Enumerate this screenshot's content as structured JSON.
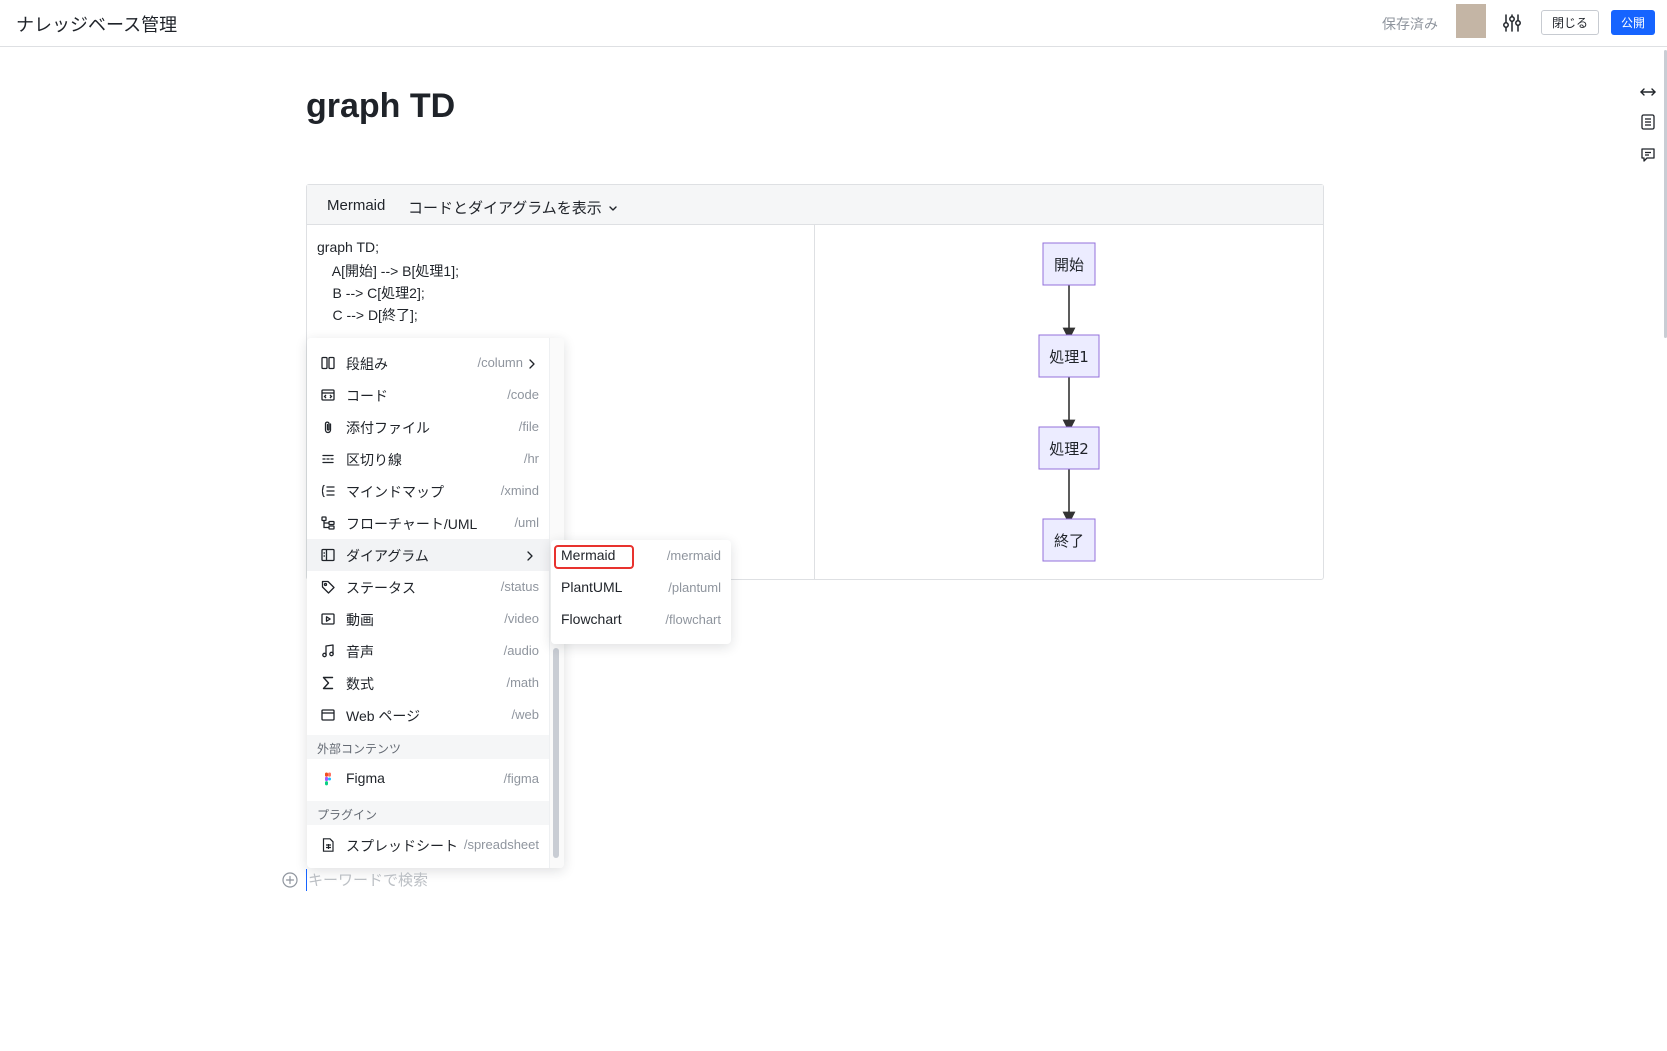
{
  "header": {
    "app_title": "ナレッジベース管理",
    "saved_status": "保存済み",
    "close_label": "閉じる",
    "publish_label": "公開",
    "avatar_color": "#c4b5a5",
    "settings_icon": "sliders-icon"
  },
  "document": {
    "title": "graph TD"
  },
  "mermaid_block": {
    "type_label": "Mermaid",
    "view_mode": "コードとダイアグラムを表示",
    "code_lines": [
      "graph TD;",
      "    A[開始] --> B[処理1];",
      "    B --> C[処理2];",
      "    C --> D[終了];"
    ],
    "diagram_nodes": [
      "開始",
      "処理1",
      "処理2",
      "終了"
    ]
  },
  "slash_menu": {
    "items": [
      {
        "label": "段組み",
        "shortcut": "/column",
        "icon": "columns-icon",
        "has_submenu": true
      },
      {
        "label": "コード",
        "shortcut": "/code",
        "icon": "code-icon"
      },
      {
        "label": "添付ファイル",
        "shortcut": "/file",
        "icon": "paperclip-icon"
      },
      {
        "label": "区切り線",
        "shortcut": "/hr",
        "icon": "divider-icon"
      },
      {
        "label": "マインドマップ",
        "shortcut": "/xmind",
        "icon": "mindmap-icon"
      },
      {
        "label": "フローチャート/UML",
        "shortcut": "/uml",
        "icon": "flowchart-icon"
      },
      {
        "label": "ダイアグラム",
        "shortcut": "",
        "icon": "diagram-icon",
        "has_submenu": true,
        "active": true
      },
      {
        "label": "ステータス",
        "shortcut": "/status",
        "icon": "tag-icon"
      },
      {
        "label": "動画",
        "shortcut": "/video",
        "icon": "video-icon"
      },
      {
        "label": "音声",
        "shortcut": "/audio",
        "icon": "music-note-icon"
      },
      {
        "label": "数式",
        "shortcut": "/math",
        "icon": "sigma-icon"
      },
      {
        "label": "Web ページ",
        "shortcut": "/web",
        "icon": "browser-icon"
      }
    ],
    "section_external": "外部コンテンツ",
    "external_items": [
      {
        "label": "Figma",
        "shortcut": "/figma",
        "icon": "figma-icon"
      }
    ],
    "section_plugins": "プラグイン",
    "plugin_items": [
      {
        "label": "スプレッドシート",
        "shortcut": "/spreadsheet",
        "icon": "spreadsheet-icon"
      }
    ]
  },
  "diagram_submenu": {
    "items": [
      {
        "label": "Mermaid",
        "shortcut": "/mermaid",
        "highlighted": true
      },
      {
        "label": "PlantUML",
        "shortcut": "/plantuml"
      },
      {
        "label": "Flowchart",
        "shortcut": "/flowchart"
      }
    ]
  },
  "search": {
    "placeholder": "キーワードで検索"
  },
  "colors": {
    "accent": "#1664ff",
    "highlight_border": "#e8322e",
    "node_fill": "#ececff",
    "node_stroke": "#9370db"
  }
}
